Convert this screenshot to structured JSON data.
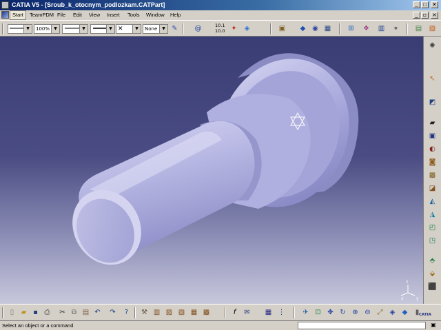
{
  "window": {
    "title": "CATIA V5 - [Sroub_k_otocnym_podlozkam.CATPart]"
  },
  "menu": {
    "items": [
      "Start",
      "TeamPDM",
      "File",
      "Edit",
      "View",
      "Insert",
      "Tools",
      "Window",
      "Help"
    ]
  },
  "graphic_properties": {
    "zoom": "100%",
    "layer": "None",
    "scale_top": "10.1",
    "scale_bottom": "10.0"
  },
  "status": {
    "message": "Select an object or a command",
    "command_value": ""
  },
  "compass": {
    "x": "x",
    "y": "y",
    "z": "z"
  },
  "logo": {
    "text": "CATIA"
  },
  "colors": {
    "title_start": "#0a246a",
    "title_end": "#a6caf0",
    "chrome": "#d4d0c8",
    "viewport_top": "#3a3d74",
    "viewport_bottom": "#c8c8dc",
    "part": "#b4b4e0"
  },
  "icons": {
    "toolbar_top": [
      "line-color-icon",
      "zoom-dropdown",
      "line-type-icon",
      "line-weight-icon",
      "point-symbol-icon",
      "layer-dropdown",
      "format-painter-icon",
      "hyperlink-icon",
      "scale-icon",
      "apply-material-icon",
      "sketcher-icon",
      "fly-mode-icon",
      "walk-icon",
      "look-at-icon",
      "catalog-icon",
      "split-view-icon",
      "knowledge-icon",
      "pan-icon"
    ],
    "right_bar": [
      "compass-icon",
      "select-arrow-icon",
      "sketch-icon",
      "pad-icon",
      "pocket-icon",
      "shaft-icon",
      "hole-icon",
      "rib-icon",
      "slot-icon",
      "stiffener-icon",
      "multi-pad-icon",
      "loft-icon",
      "fillet-icon",
      "chamfer-icon",
      "draft-icon",
      "shell-icon",
      "thickness-icon"
    ],
    "toolbar_bottom": [
      "new-icon",
      "open-icon",
      "save-icon",
      "print-icon",
      "cut-icon",
      "copy-icon",
      "paste-icon",
      "undo-icon",
      "redo-icon",
      "whats-this-icon",
      "measure-icon",
      "formula-icon",
      "comment-icon",
      "table-icon",
      "tree-icon",
      "fit-all-icon",
      "pan-icon",
      "rotate-icon",
      "zoom-in-icon",
      "zoom-out-icon",
      "normal-view-icon",
      "views-icon",
      "render-style-icon",
      "hide-show-icon",
      "swap-space-icon"
    ]
  }
}
